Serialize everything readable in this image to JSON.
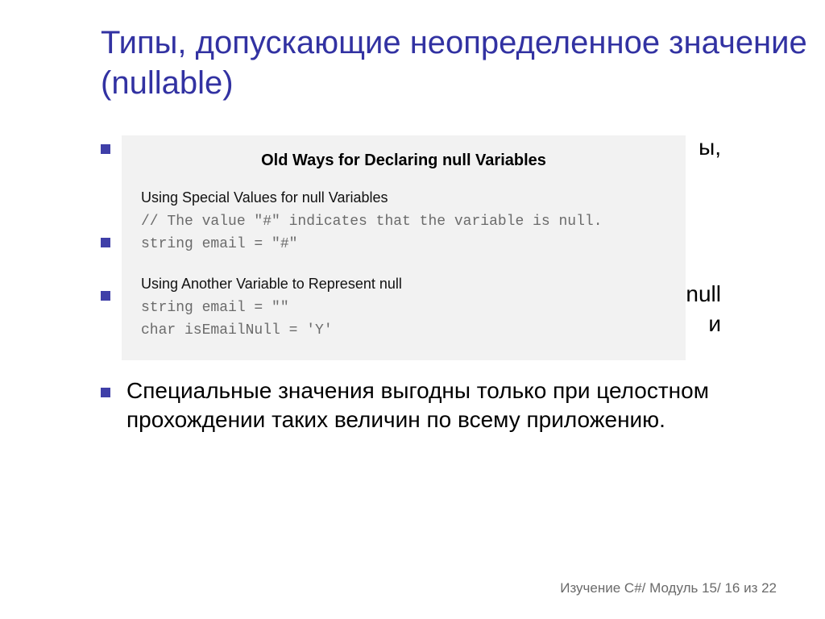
{
  "title": "Типы, допускающие неопределенное значение (nullable)",
  "bullets": {
    "b1_tail": "ы,",
    "b2": "",
    "b3_line1_tail": "null",
    "b3_line2_tail": "и",
    "b4": "Специальные значения выгодны только при целостном прохождении таких величин по всему приложению."
  },
  "codebox": {
    "title": "Old Ways for Declaring null Variables",
    "section1_label": "Using Special Values for null Variables",
    "section1_line1": "// The value \"#\" indicates that the variable is null.",
    "section1_line2": "string email = \"#\"",
    "section2_label": "Using Another Variable to Represent null",
    "section2_line1": "string email = \"\"",
    "section2_line2": "char isEmailNull = 'Y'"
  },
  "footer": "Изучение C#/ Модуль 15/ 16 из 22"
}
